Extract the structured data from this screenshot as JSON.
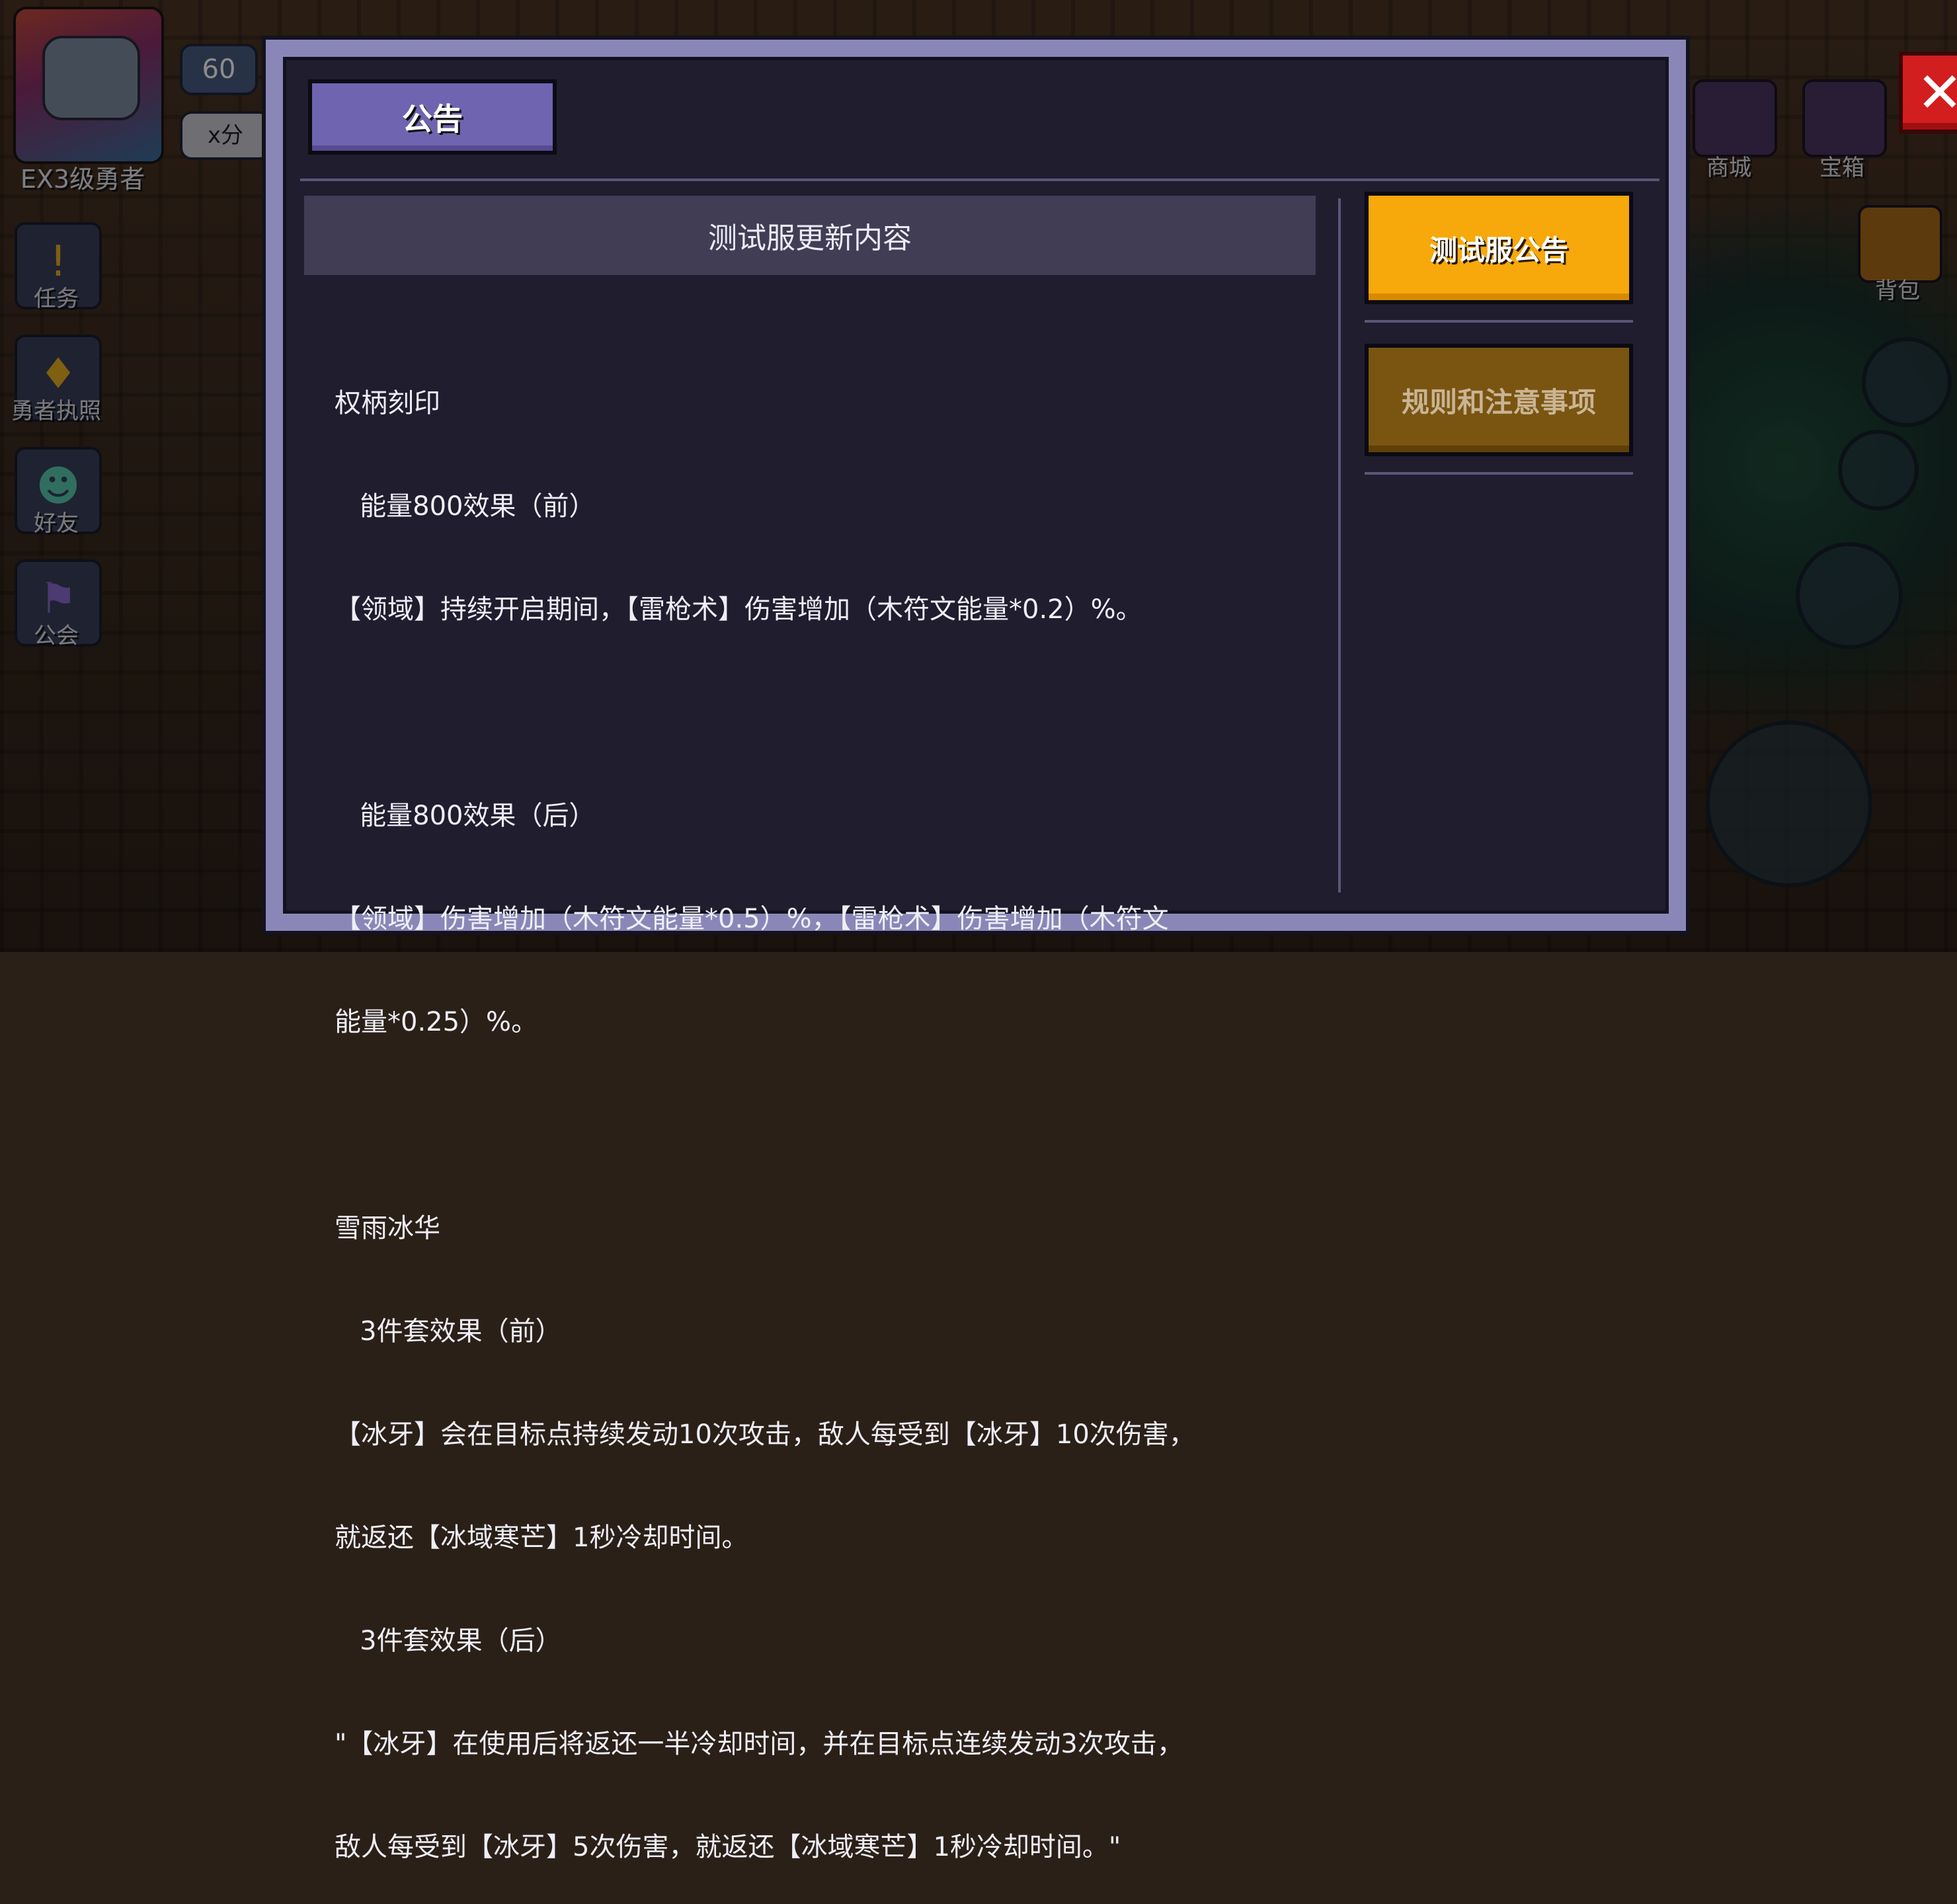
{
  "hud": {
    "level": "60",
    "score_badge": "x分",
    "rank": "EX3级勇者",
    "left_menu": [
      {
        "label": "任务",
        "icon": "quest-icon"
      },
      {
        "label": "勇者执照",
        "icon": "license-icon"
      },
      {
        "label": "好友",
        "icon": "friends-icon"
      },
      {
        "label": "公会",
        "icon": "guild-icon"
      }
    ],
    "right_menu": [
      {
        "label": "商城",
        "icon": "shop-icon"
      },
      {
        "label": "宝箱",
        "icon": "chest-icon"
      },
      {
        "label": "背包",
        "icon": "backpack-icon"
      }
    ]
  },
  "dialog": {
    "tab_label": "公告",
    "close_symbol": "✕",
    "content_title": "测试服更新内容",
    "content_lines": [
      "权柄刻印",
      "   能量800效果（前）",
      "【领域】持续开启期间，【雷枪术】伤害增加（木符文能量*0.2）%。",
      "",
      "   能量800效果（后）",
      "【领域】伤害增加（木符文能量*0.5）%，【雷枪术】伤害增加（木符文",
      "能量*0.25）%。",
      "",
      "雪雨冰华",
      "   3件套效果（前）",
      "【冰牙】会在目标点持续发动10次攻击，敌人每受到【冰牙】10次伤害，",
      "就返还【冰域寒芒】1秒冷却时间。",
      "   3件套效果（后）",
      "\"【冰牙】在使用后将返还一半冷却时间，并在目标点连续发动3次攻击，",
      "敌人每受到【冰牙】5次伤害，就返还【冰域寒芒】1秒冷却时间。\""
    ],
    "side_buttons": [
      {
        "label": "测试服公告",
        "active": true
      },
      {
        "label": "规则和注意事项",
        "active": false
      }
    ]
  },
  "colors": {
    "dialog_frame": "#8a87b8",
    "dialog_bg": "#1f1d2e",
    "tab_bg": "#6f64b0",
    "active_button": "#f7a80a",
    "inactive_button": "#7a5512",
    "close_button": "#d21e1e"
  }
}
